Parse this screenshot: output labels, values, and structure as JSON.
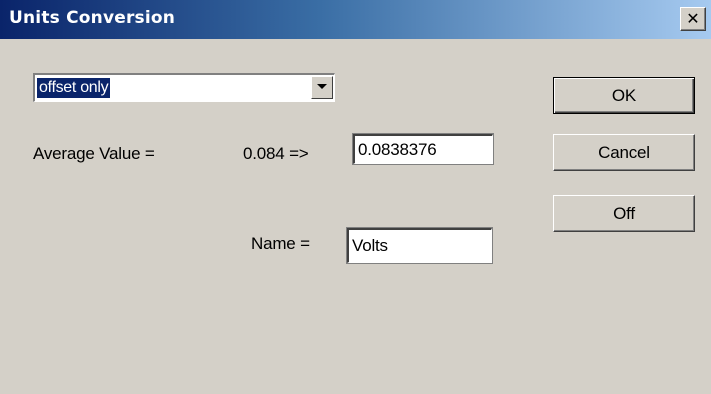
{
  "window": {
    "title": "Units Conversion",
    "close_glyph": "✕",
    "close_icon": "close-icon"
  },
  "mode_select": {
    "selected": "offset only",
    "arrow_icon": "chevron-down-icon"
  },
  "average": {
    "label": "Average Value =",
    "measured": "0.084 =>",
    "value": "0.0838376"
  },
  "name": {
    "label": "Name =",
    "value": "Volts"
  },
  "buttons": {
    "ok": "OK",
    "cancel": "Cancel",
    "off": "Off"
  },
  "colors": {
    "face": "#d4d0c8",
    "title_start": "#0a246a",
    "title_end": "#a6caf0",
    "selection": "#0a246a"
  }
}
